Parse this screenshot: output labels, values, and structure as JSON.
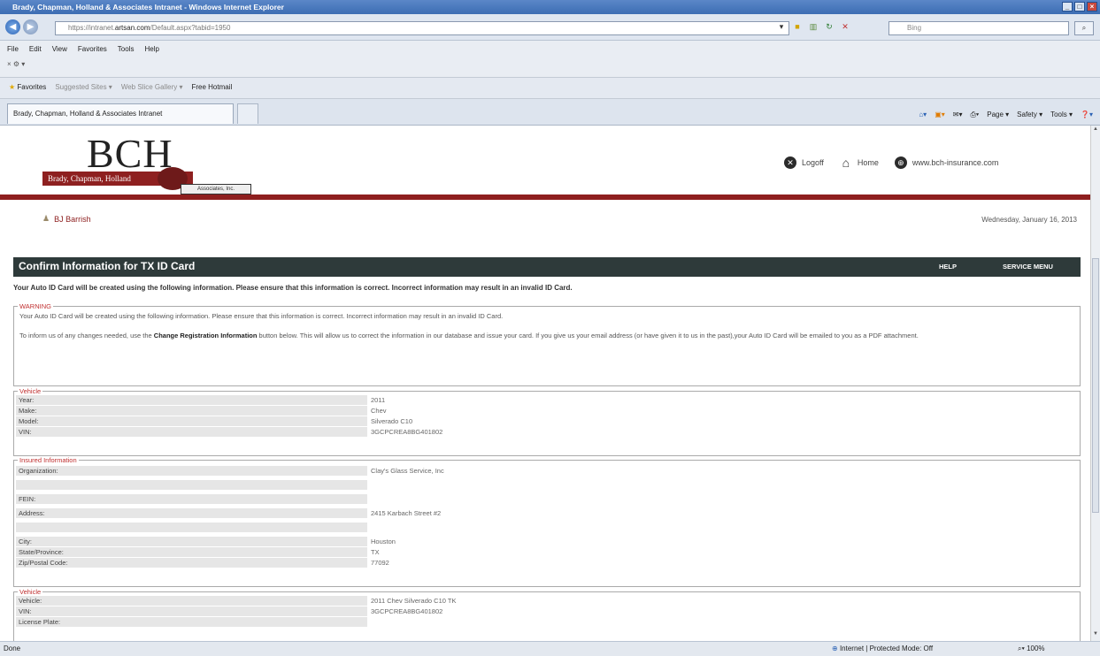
{
  "browser": {
    "title": "Brady, Chapman, Holland & Associates Intranet - Windows Internet Explorer",
    "url_prefix": "https://intranet.",
    "url_domain": "artsan.com",
    "url_suffix": "/Default.aspx?tabid=1950",
    "search_placeholder": "Bing",
    "menu": [
      "File",
      "Edit",
      "View",
      "Favorites",
      "Tools",
      "Help"
    ],
    "favorites_label": "Favorites",
    "fav_links": [
      "Suggested Sites ▾",
      "Web Slice Gallery ▾",
      "Free Hotmail"
    ],
    "tab_title": "Brady, Chapman, Holland & Associates Intranet",
    "commands": [
      "Page ▾",
      "Safety ▾",
      "Tools ▾"
    ],
    "status_left": "Done",
    "status_zone": "Internet | Protected Mode: Off",
    "status_zoom": "100%"
  },
  "site": {
    "logo_text": "BCH",
    "logo_ribbon": "Brady, Chapman, Holland",
    "logo_assoc": "Associates, Inc.",
    "links": {
      "logoff": "Logoff",
      "home": "Home",
      "website": "www.bch-insurance.com"
    },
    "user": "BJ Barrish",
    "date": "Wednesday, January 16, 2013"
  },
  "form": {
    "title": "Confirm Information for TX ID Card",
    "help": "HELP",
    "service_menu": "SERVICE MENU",
    "notice": "Your Auto ID Card will be created using the following information. Please ensure that this information is correct. Incorrect information may result in an invalid ID Card.",
    "warning": {
      "legend": "WARNING",
      "line1": "Your Auto ID Card will be created using the following information. Please ensure that this information is correct. Incorrect information may result in an invalid ID Card.",
      "line2_pre": "To inform us of any changes needed, use the",
      "line2_bold": "Change Registration Information",
      "line2_post": "button below. This will allow us to correct the information in our database and issue your card. If you give us your email address (or have given it to us in the past),your Auto ID Card will be emailed to you as a PDF attachment."
    },
    "vehicle1": {
      "legend": "Vehicle",
      "rows": [
        {
          "label": "Year:",
          "value": "2011"
        },
        {
          "label": "Make:",
          "value": "Chev"
        },
        {
          "label": "Model:",
          "value": "Silverado C10"
        },
        {
          "label": "VIN:",
          "value": "3GCPCREA8BG401802"
        }
      ]
    },
    "insured": {
      "legend": "Insured Information",
      "rows": [
        {
          "label": "Organization:",
          "value": "Clay's Glass Service, Inc"
        },
        {
          "label": "",
          "value": ""
        },
        {
          "label": "FEIN:",
          "value": ""
        },
        {
          "label": "Address:",
          "value": "2415 Karbach Street #2"
        },
        {
          "label": "",
          "value": ""
        },
        {
          "label": "City:",
          "value": "Houston"
        },
        {
          "label": "State/Province:",
          "value": "TX"
        },
        {
          "label": "Zip/Postal Code:",
          "value": "77092"
        }
      ]
    },
    "vehicle2": {
      "legend": "Vehicle",
      "rows": [
        {
          "label": "Vehicle:",
          "value": "2011 Chev Silverado C10 TK"
        },
        {
          "label": "VIN:",
          "value": "3GCPCREA8BG401802"
        },
        {
          "label": "License Plate:",
          "value": ""
        }
      ]
    }
  }
}
